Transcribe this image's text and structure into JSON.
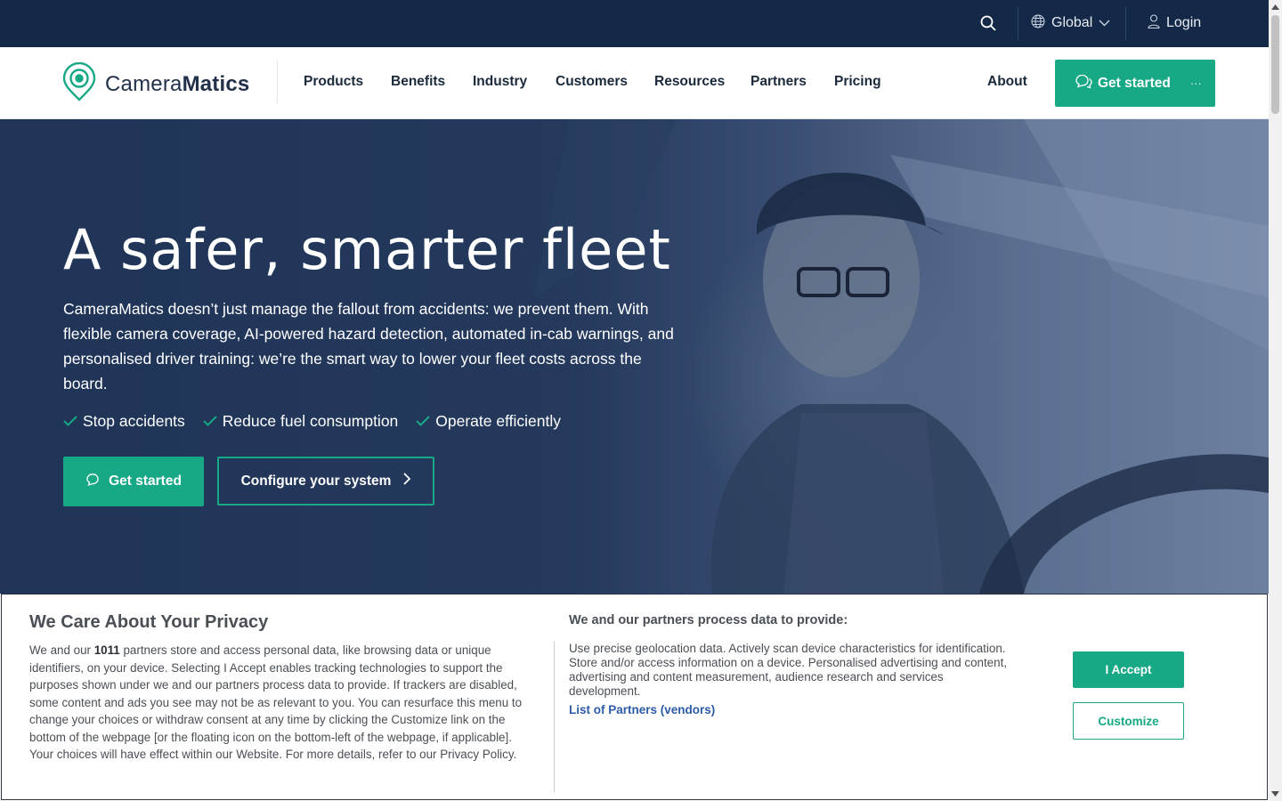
{
  "topbar": {
    "region_label": "Global",
    "login_label": "Login"
  },
  "header": {
    "logo": {
      "light": "Camera",
      "bold": "Matics"
    },
    "nav": [
      "Products",
      "Benefits",
      "Industry",
      "Customers",
      "Resources",
      "Partners",
      "Pricing"
    ],
    "about_label": "About",
    "cta_label": "Get started",
    "cta_more": "···"
  },
  "hero": {
    "title": "A safer, smarter fleet",
    "description": "CameraMatics doesn’t just manage the fallout from accidents: we prevent them. With flexible camera coverage, AI-powered hazard detection, automated in-cab warnings, and personalised driver training: we’re the smart way to lower your fleet costs across the board.",
    "checks": [
      "Stop accidents",
      "Reduce fuel consumption",
      "Operate efficiently"
    ],
    "primary_button": "Get started",
    "secondary_button": "Configure your system"
  },
  "privacy": {
    "title": "We Care About Your Privacy",
    "body_prefix": "We and our ",
    "partner_count": "1011",
    "body_suffix": " partners store and access personal data, like browsing data or unique identifiers, on your device. Selecting I Accept enables tracking technologies to support the purposes shown under we and our partners process data to provide. If trackers are disabled, some content and ads you see may not be as relevant to you. You can resurface this menu to change your choices or withdraw consent at any time by clicking the Customize link on the bottom of the webpage [or the floating icon on the bottom-left of the webpage, if applicable]. Your choices will have effect within our Website. For more details, refer to our Privacy Policy.",
    "purposes_title": "We and our partners process data to provide:",
    "purposes_text": "Use precise geolocation data. Actively scan device characteristics for identification. Store and/or access information on a device. Personalised advertising and content, advertising and content measurement, audience research and services development.",
    "partners_link": "List of Partners (vendors)",
    "accept_label": "I Accept",
    "customize_label": "Customize"
  },
  "colors": {
    "navy": "#142847",
    "accent_green": "#17a886",
    "link_blue": "#2c5ba8"
  },
  "icons": [
    "search-icon",
    "globe-icon",
    "chevron-down-icon",
    "user-icon",
    "location-pin-icon",
    "chat-icon",
    "check-icon",
    "chevron-right-icon"
  ]
}
